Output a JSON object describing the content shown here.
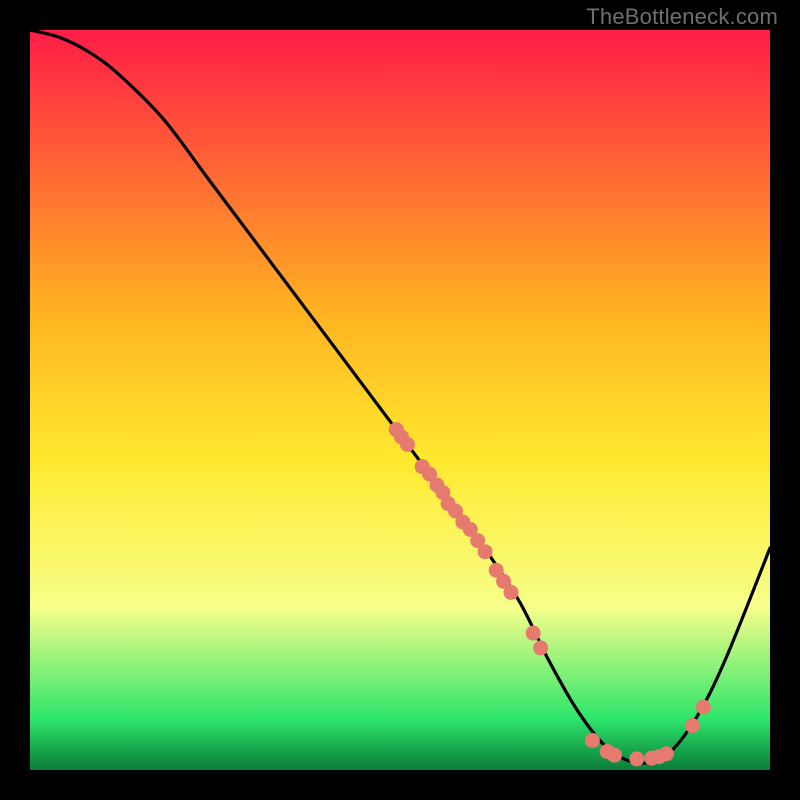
{
  "watermark": "TheBottleneck.com",
  "colors": {
    "bg_black": "#000000",
    "curve": "#000000",
    "dots": "#e67a6f",
    "gradient_top": "#ff1c47",
    "gradient_mid_upper": "#ffb222",
    "gradient_mid": "#ffe92e",
    "gradient_mid_lower": "#f7ff8a",
    "gradient_green": "#2ee66b",
    "gradient_bottom": "#0a7d3a"
  },
  "chart_data": {
    "type": "line",
    "title": "",
    "xlabel": "",
    "ylabel": "",
    "xlim": [
      0,
      100
    ],
    "ylim": [
      0,
      100
    ],
    "grid": false,
    "legend": false,
    "series": [
      {
        "name": "curve",
        "x": [
          0,
          4,
          8,
          12,
          18,
          24,
          30,
          36,
          42,
          48,
          54,
          60,
          66,
          70,
          74,
          78,
          82,
          86,
          90,
          94,
          100
        ],
        "y": [
          100,
          99,
          97,
          94,
          88,
          80,
          72,
          64,
          56,
          48,
          40,
          32,
          23,
          15,
          8,
          3,
          1,
          2,
          7,
          15,
          30
        ]
      }
    ],
    "scatter": [
      {
        "x": 49.5,
        "y": 46.0
      },
      {
        "x": 50.2,
        "y": 45.0
      },
      {
        "x": 51.0,
        "y": 44.0
      },
      {
        "x": 53.0,
        "y": 41.0
      },
      {
        "x": 54.0,
        "y": 40.0
      },
      {
        "x": 55.0,
        "y": 38.5
      },
      {
        "x": 55.8,
        "y": 37.5
      },
      {
        "x": 56.5,
        "y": 36.0
      },
      {
        "x": 57.5,
        "y": 35.0
      },
      {
        "x": 58.5,
        "y": 33.5
      },
      {
        "x": 59.5,
        "y": 32.5
      },
      {
        "x": 60.5,
        "y": 31.0
      },
      {
        "x": 61.5,
        "y": 29.5
      },
      {
        "x": 63.0,
        "y": 27.0
      },
      {
        "x": 64.0,
        "y": 25.5
      },
      {
        "x": 65.0,
        "y": 24.0
      },
      {
        "x": 68.0,
        "y": 18.5
      },
      {
        "x": 69.0,
        "y": 16.5
      },
      {
        "x": 76.0,
        "y": 4.0
      },
      {
        "x": 78.0,
        "y": 2.5
      },
      {
        "x": 79.0,
        "y": 2.0
      },
      {
        "x": 82.0,
        "y": 1.5
      },
      {
        "x": 84.0,
        "y": 1.6
      },
      {
        "x": 85.0,
        "y": 1.8
      },
      {
        "x": 86.0,
        "y": 2.2
      },
      {
        "x": 89.5,
        "y": 6.0
      },
      {
        "x": 91.0,
        "y": 8.5
      }
    ]
  }
}
